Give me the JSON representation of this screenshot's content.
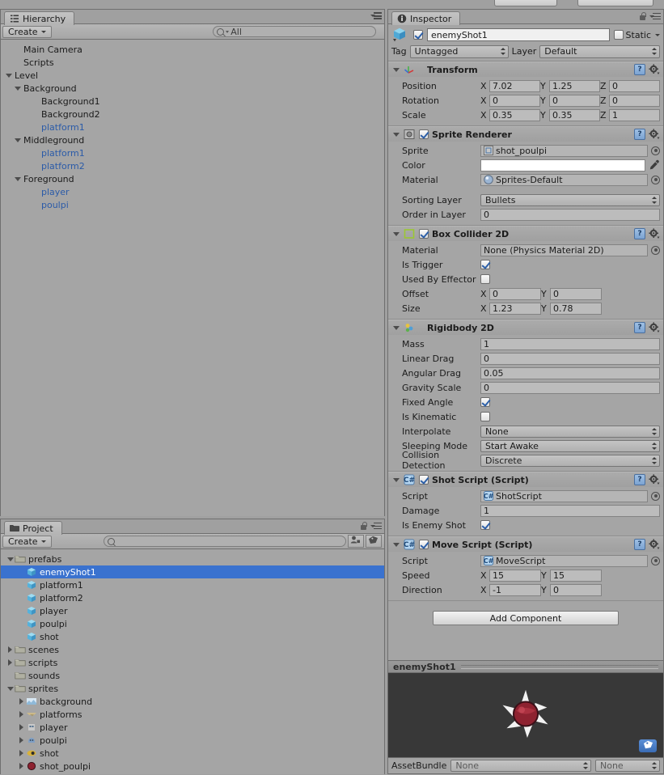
{
  "app": "Unity Editor",
  "hierarchy": {
    "tab_label": "Hierarchy",
    "tab_icon": "hierarchy-icon",
    "create_label": "Create",
    "search_value": "All",
    "search_placeholder": "All",
    "items": [
      {
        "label": "Main Camera",
        "depth": 1,
        "arrow": "none",
        "prefab": false
      },
      {
        "label": "Scripts",
        "depth": 1,
        "arrow": "none",
        "prefab": false
      },
      {
        "label": "Level",
        "depth": 0,
        "arrow": "down",
        "prefab": false
      },
      {
        "label": "Background",
        "depth": 1,
        "arrow": "down",
        "prefab": false
      },
      {
        "label": "Background1",
        "depth": 3,
        "arrow": "none",
        "prefab": false
      },
      {
        "label": "Background2",
        "depth": 3,
        "arrow": "none",
        "prefab": false
      },
      {
        "label": "platform1",
        "depth": 3,
        "arrow": "none",
        "prefab": true
      },
      {
        "label": "Middleground",
        "depth": 1,
        "arrow": "down",
        "prefab": false
      },
      {
        "label": "platform1",
        "depth": 3,
        "arrow": "none",
        "prefab": true
      },
      {
        "label": "platform2",
        "depth": 3,
        "arrow": "none",
        "prefab": true
      },
      {
        "label": "Foreground",
        "depth": 1,
        "arrow": "down",
        "prefab": false
      },
      {
        "label": "player",
        "depth": 3,
        "arrow": "none",
        "prefab": true
      },
      {
        "label": "poulpi",
        "depth": 3,
        "arrow": "none",
        "prefab": true
      }
    ]
  },
  "project": {
    "tab_label": "Project",
    "tab_icon": "folder-icon",
    "create_label": "Create",
    "search_value": "",
    "search_placeholder": "",
    "items": [
      {
        "label": "prefabs",
        "depth": 0,
        "arrow": "down",
        "icon": "folder-icon",
        "selected": false
      },
      {
        "label": "enemyShot1",
        "depth": 1,
        "arrow": "none",
        "icon": "prefab-icon",
        "selected": true
      },
      {
        "label": "platform1",
        "depth": 1,
        "arrow": "none",
        "icon": "prefab-icon",
        "selected": false
      },
      {
        "label": "platform2",
        "depth": 1,
        "arrow": "none",
        "icon": "prefab-icon",
        "selected": false
      },
      {
        "label": "player",
        "depth": 1,
        "arrow": "none",
        "icon": "prefab-icon",
        "selected": false
      },
      {
        "label": "poulpi",
        "depth": 1,
        "arrow": "none",
        "icon": "prefab-icon",
        "selected": false
      },
      {
        "label": "shot",
        "depth": 1,
        "arrow": "none",
        "icon": "prefab-icon",
        "selected": false
      },
      {
        "label": "scenes",
        "depth": 0,
        "arrow": "right",
        "icon": "folder-icon",
        "selected": false
      },
      {
        "label": "scripts",
        "depth": 0,
        "arrow": "right",
        "icon": "folder-icon",
        "selected": false
      },
      {
        "label": "sounds",
        "depth": 0,
        "arrow": "none",
        "icon": "folder-icon",
        "selected": false
      },
      {
        "label": "sprites",
        "depth": 0,
        "arrow": "down",
        "icon": "folder-icon",
        "selected": false
      },
      {
        "label": "background",
        "depth": 1,
        "arrow": "right",
        "icon": "sprite-background-icon",
        "selected": false
      },
      {
        "label": "platforms",
        "depth": 1,
        "arrow": "right",
        "icon": "sprite-platforms-icon",
        "selected": false
      },
      {
        "label": "player",
        "depth": 1,
        "arrow": "right",
        "icon": "sprite-player-icon",
        "selected": false
      },
      {
        "label": "poulpi",
        "depth": 1,
        "arrow": "right",
        "icon": "sprite-poulpi-icon",
        "selected": false
      },
      {
        "label": "shot",
        "depth": 1,
        "arrow": "right",
        "icon": "sprite-shot-icon",
        "selected": false
      },
      {
        "label": "shot_poulpi",
        "depth": 1,
        "arrow": "right",
        "icon": "sprite-shotpoulpi-icon",
        "selected": false
      }
    ]
  },
  "inspector": {
    "tab_label": "Inspector",
    "tab_icon": "info-icon",
    "object": {
      "enabled": true,
      "name": "enemyShot1",
      "static_label": "Static",
      "static_checked": false,
      "tag_label": "Tag",
      "tag_value": "Untagged",
      "layer_label": "Layer",
      "layer_value": "Default"
    },
    "components": [
      {
        "title": "Transform",
        "icon": "transform-icon",
        "has_enable_checkbox": false,
        "enabled": true,
        "rows": [
          {
            "type": "xyz",
            "label": "Position",
            "axes": [
              "X",
              "Y",
              "Z"
            ],
            "values": [
              "7.02",
              "1.25",
              "0"
            ]
          },
          {
            "type": "xyz",
            "label": "Rotation",
            "axes": [
              "X",
              "Y",
              "Z"
            ],
            "values": [
              "0",
              "0",
              "0"
            ]
          },
          {
            "type": "xyz",
            "label": "Scale",
            "axes": [
              "X",
              "Y",
              "Z"
            ],
            "values": [
              "0.35",
              "0.35",
              "1"
            ]
          }
        ]
      },
      {
        "title": "Sprite Renderer",
        "icon": "sprite-renderer-icon",
        "has_enable_checkbox": true,
        "enabled": true,
        "rows": [
          {
            "type": "object",
            "label": "Sprite",
            "value": "shot_poulpi",
            "icon": "sprite-asset-icon"
          },
          {
            "type": "color",
            "label": "Color",
            "value": "#ffffff"
          },
          {
            "type": "object",
            "label": "Material",
            "value": "Sprites-Default",
            "icon": "material-asset-icon"
          },
          {
            "type": "gap"
          },
          {
            "type": "dropdown",
            "label": "Sorting Layer",
            "value": "Bullets"
          },
          {
            "type": "text",
            "label": "Order in Layer",
            "value": "0"
          }
        ]
      },
      {
        "title": "Box Collider 2D",
        "icon": "box-collider-2d-icon",
        "has_enable_checkbox": true,
        "enabled": true,
        "rows": [
          {
            "type": "object",
            "label": "Material",
            "value": "None (Physics Material 2D)",
            "icon": "none-asset-icon"
          },
          {
            "type": "checkbox",
            "label": "Is Trigger",
            "checked": true
          },
          {
            "type": "checkbox",
            "label": "Used By Effector",
            "checked": false
          },
          {
            "type": "xy",
            "label": "Offset",
            "axes": [
              "X",
              "Y"
            ],
            "values": [
              "0",
              "0"
            ]
          },
          {
            "type": "xy",
            "label": "Size",
            "axes": [
              "X",
              "Y"
            ],
            "values": [
              "1.23",
              "0.78"
            ]
          }
        ]
      },
      {
        "title": "Rigidbody 2D",
        "icon": "rigidbody-2d-icon",
        "has_enable_checkbox": false,
        "enabled": true,
        "rows": [
          {
            "type": "text",
            "label": "Mass",
            "value": "1"
          },
          {
            "type": "text",
            "label": "Linear Drag",
            "value": "0"
          },
          {
            "type": "text",
            "label": "Angular Drag",
            "value": "0.05"
          },
          {
            "type": "text",
            "label": "Gravity Scale",
            "value": "0"
          },
          {
            "type": "checkbox",
            "label": "Fixed Angle",
            "checked": true
          },
          {
            "type": "checkbox",
            "label": "Is Kinematic",
            "checked": false
          },
          {
            "type": "dropdown",
            "label": "Interpolate",
            "value": "None"
          },
          {
            "type": "dropdown",
            "label": "Sleeping Mode",
            "value": "Start Awake"
          },
          {
            "type": "dropdown",
            "label": "Collision Detection",
            "value": "Discrete"
          }
        ]
      },
      {
        "title": "Shot Script (Script)",
        "icon": "csharp-script-icon",
        "has_enable_checkbox": true,
        "enabled": true,
        "rows": [
          {
            "type": "object",
            "label": "Script",
            "value": "ShotScript",
            "icon": "csharp-asset-icon"
          },
          {
            "type": "text",
            "label": "Damage",
            "value": "1"
          },
          {
            "type": "checkbox",
            "label": "Is Enemy Shot",
            "checked": true
          }
        ]
      },
      {
        "title": "Move Script (Script)",
        "icon": "csharp-script-icon",
        "has_enable_checkbox": true,
        "enabled": true,
        "rows": [
          {
            "type": "object",
            "label": "Script",
            "value": "MoveScript",
            "icon": "csharp-asset-icon"
          },
          {
            "type": "xy",
            "label": "Speed",
            "axes": [
              "X",
              "Y"
            ],
            "values": [
              "15",
              "15"
            ]
          },
          {
            "type": "xy",
            "label": "Direction",
            "axes": [
              "X",
              "Y"
            ],
            "values": [
              "-1",
              "0"
            ]
          }
        ]
      }
    ],
    "add_component_label": "Add Component",
    "preview": {
      "title": "enemyShot1",
      "sprite": "spiky-red-ball-sprite",
      "badge_icon": "tag-icon"
    },
    "asset_bundle": {
      "label": "AssetBundle",
      "name_value": "None",
      "variant_value": "None"
    }
  },
  "colors": {
    "selection_blue": "#3a72cf",
    "prefab_blue": "#2b5ba8",
    "panel_gray": "#a5a5a5",
    "preview_bg": "#383838"
  }
}
